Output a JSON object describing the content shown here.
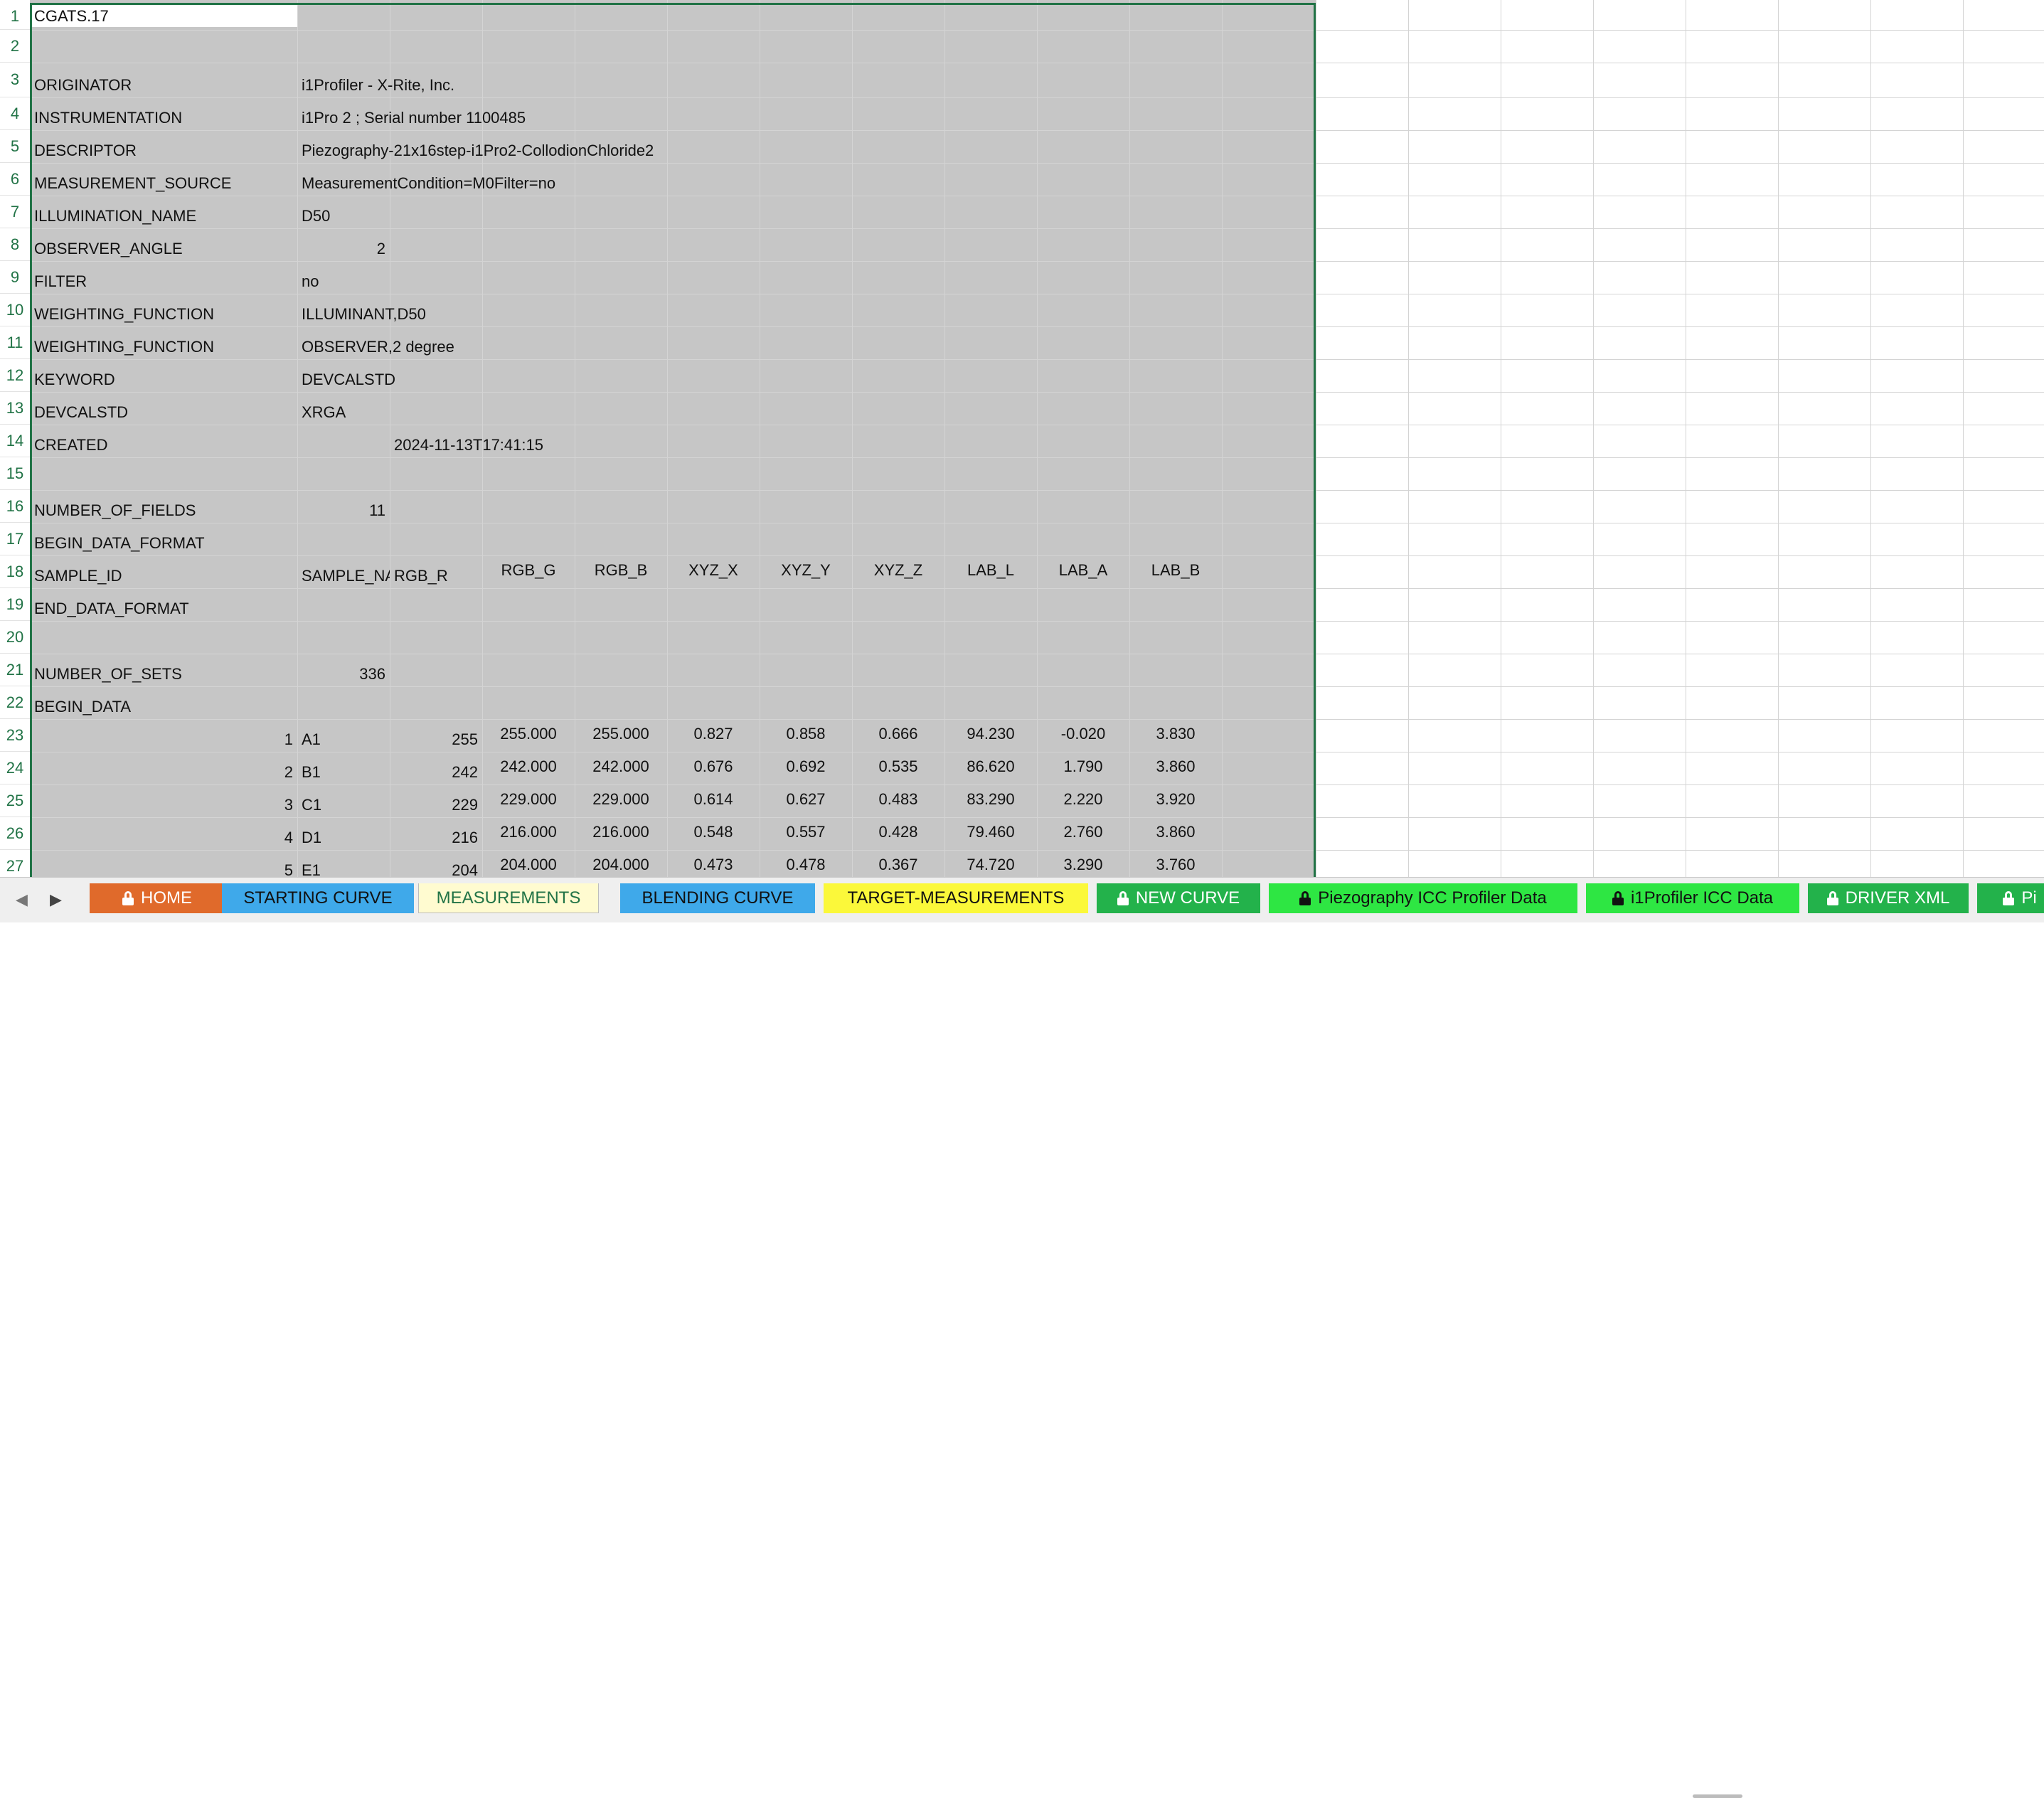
{
  "rows": [
    {
      "num": "1",
      "cells": [
        "CGATS.17"
      ]
    },
    {
      "num": "2",
      "cells": []
    },
    {
      "num": "3",
      "cells": [
        "ORIGINATOR",
        "i1Profiler - X-Rite, Inc."
      ]
    },
    {
      "num": "4",
      "cells": [
        "INSTRUMENTATION",
        "i1Pro 2 ; Serial number 1100485"
      ]
    },
    {
      "num": "5",
      "cells": [
        "DESCRIPTOR",
        "Piezography-21x16step-i1Pro2-CollodionChloride2"
      ]
    },
    {
      "num": "6",
      "cells": [
        "MEASUREMENT_SOURCE",
        "MeasurementCondition=M0Filter=no"
      ]
    },
    {
      "num": "7",
      "cells": [
        "ILLUMINATION_NAME",
        "D50"
      ]
    },
    {
      "num": "8",
      "cells": [
        "OBSERVER_ANGLE",
        "2"
      ]
    },
    {
      "num": "9",
      "cells": [
        "FILTER",
        "no"
      ]
    },
    {
      "num": "10",
      "cells": [
        "WEIGHTING_FUNCTION",
        "ILLUMINANT,D50"
      ]
    },
    {
      "num": "11",
      "cells": [
        "WEIGHTING_FUNCTION",
        "OBSERVER,2 degree"
      ]
    },
    {
      "num": "12",
      "cells": [
        "KEYWORD",
        "DEVCALSTD"
      ]
    },
    {
      "num": "13",
      "cells": [
        "DEVCALSTD",
        "XRGA"
      ]
    },
    {
      "num": "14",
      "cells": [
        "CREATED",
        "2024-11-13T17:41:15"
      ]
    },
    {
      "num": "15",
      "cells": []
    },
    {
      "num": "16",
      "cells": [
        "NUMBER_OF_FIELDS",
        "11"
      ]
    },
    {
      "num": "17",
      "cells": [
        "BEGIN_DATA_FORMAT"
      ]
    },
    {
      "num": "18",
      "cells": [
        "SAMPLE_ID",
        "SAMPLE_NA",
        "RGB_R",
        "RGB_G",
        "RGB_B",
        "XYZ_X",
        "XYZ_Y",
        "XYZ_Z",
        "LAB_L",
        "LAB_A",
        "LAB_B"
      ]
    },
    {
      "num": "19",
      "cells": [
        "END_DATA_FORMAT"
      ]
    },
    {
      "num": "20",
      "cells": []
    },
    {
      "num": "21",
      "cells": [
        "NUMBER_OF_SETS",
        "336"
      ]
    },
    {
      "num": "22",
      "cells": [
        "BEGIN_DATA"
      ]
    },
    {
      "num": "23",
      "cells": [
        "1",
        "A1",
        "255",
        "255.000",
        "255.000",
        "0.827",
        "0.858",
        "0.666",
        "94.230",
        "-0.020",
        "3.830"
      ]
    },
    {
      "num": "24",
      "cells": [
        "2",
        "B1",
        "242",
        "242.000",
        "242.000",
        "0.676",
        "0.692",
        "0.535",
        "86.620",
        "1.790",
        "3.860"
      ]
    },
    {
      "num": "25",
      "cells": [
        "3",
        "C1",
        "229",
        "229.000",
        "229.000",
        "0.614",
        "0.627",
        "0.483",
        "83.290",
        "2.220",
        "3.920"
      ]
    },
    {
      "num": "26",
      "cells": [
        "4",
        "D1",
        "216",
        "216.000",
        "216.000",
        "0.548",
        "0.557",
        "0.428",
        "79.460",
        "2.760",
        "3.860"
      ]
    },
    {
      "num": "27",
      "cells": [
        "5",
        "E1",
        "204",
        "204.000",
        "204.000",
        "0.473",
        "0.478",
        "0.367",
        "74.720",
        "3.290",
        "3.760"
      ]
    }
  ],
  "tabs": [
    {
      "label": "HOME",
      "locked": true,
      "bg": "#e06a2b",
      "fg": "#ffffff"
    },
    {
      "label": "STARTING CURVE",
      "locked": false,
      "bg": "#3fa9ea",
      "fg": "#111111"
    },
    {
      "label": "MEASUREMENTS",
      "locked": false,
      "bg": "#fffbd0",
      "fg": "#217346",
      "active": true
    },
    {
      "label": "BLENDING CURVE",
      "locked": false,
      "bg": "#3fa9ea",
      "fg": "#111111"
    },
    {
      "label": "TARGET-MEASUREMENTS",
      "locked": false,
      "bg": "#fbf83a",
      "fg": "#111111"
    },
    {
      "label": "NEW CURVE",
      "locked": true,
      "bg": "#23b24b",
      "fg": "#ffffff"
    },
    {
      "label": "Piezography ICC Profiler Data",
      "locked": true,
      "bg": "#2ee643",
      "fg": "#111111"
    },
    {
      "label": "i1Profiler ICC Data",
      "locked": true,
      "bg": "#2ee643",
      "fg": "#111111"
    },
    {
      "label": "DRIVER XML",
      "locked": true,
      "bg": "#23b24b",
      "fg": "#ffffff"
    },
    {
      "label": "Pi",
      "locked": true,
      "bg": "#23b24b",
      "fg": "#ffffff"
    }
  ],
  "nav": {
    "prev": "◀",
    "next": "▶"
  },
  "colors": {
    "header_green": "#217346",
    "shade": "#c6c6c6"
  }
}
